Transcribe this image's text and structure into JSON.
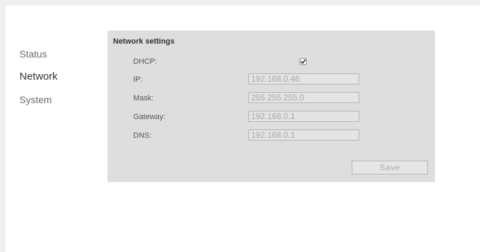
{
  "nav": {
    "items": [
      {
        "label": "Status",
        "active": false
      },
      {
        "label": "Network",
        "active": true
      },
      {
        "label": "System",
        "active": false
      }
    ]
  },
  "panel": {
    "title": "Network settings",
    "dhcp": {
      "label": "DHCP:",
      "checked": true
    },
    "ip": {
      "label": "IP:",
      "value": "192.168.0.46"
    },
    "mask": {
      "label": "Mask:",
      "value": "255.255.255.0"
    },
    "gateway": {
      "label": "Gateway:",
      "value": "192.168.0.1"
    },
    "dns": {
      "label": "DNS:",
      "value": "192.168.0.1"
    },
    "save_label": "Save"
  }
}
